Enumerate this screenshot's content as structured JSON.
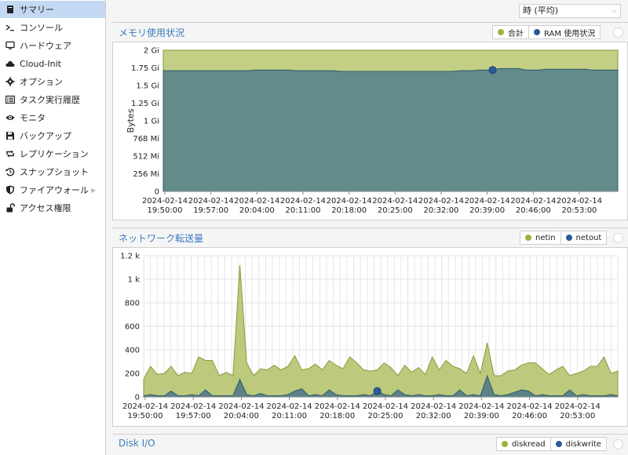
{
  "sidebar": {
    "items": [
      {
        "label": "サマリー",
        "icon": "book-icon"
      },
      {
        "label": "コンソール",
        "icon": "terminal-icon"
      },
      {
        "label": "ハードウェア",
        "icon": "desktop-icon"
      },
      {
        "label": "Cloud-Init",
        "icon": "cloud-icon"
      },
      {
        "label": "オプション",
        "icon": "gear-icon"
      },
      {
        "label": "タスク実行履歴",
        "icon": "list-icon"
      },
      {
        "label": "モニタ",
        "icon": "eye-icon"
      },
      {
        "label": "バックアップ",
        "icon": "floppy-icon"
      },
      {
        "label": "レプリケーション",
        "icon": "retweet-icon"
      },
      {
        "label": "スナップショット",
        "icon": "history-icon"
      },
      {
        "label": "ファイアウォール",
        "icon": "shield-icon"
      },
      {
        "label": "アクセス権限",
        "icon": "unlock-icon"
      }
    ]
  },
  "toolbar": {
    "timeframe": "時 (平均)"
  },
  "memory_panel": {
    "title": "メモリ使用状況",
    "legend": [
      {
        "label": "合計",
        "color": "#b5c46e"
      },
      {
        "label": "RAM 使用状況",
        "color": "#2b5c99"
      }
    ]
  },
  "network_panel": {
    "title": "ネットワーク転送量",
    "legend": [
      {
        "label": "netin",
        "color": "#9cb43c"
      },
      {
        "label": "netout",
        "color": "#2b5c99"
      }
    ]
  },
  "disk_panel": {
    "title": "Disk I/O",
    "legend": [
      {
        "label": "diskread",
        "color": "#9cb43c"
      },
      {
        "label": "diskwrite",
        "color": "#2b5c99"
      }
    ]
  },
  "chart_data": [
    {
      "type": "area",
      "ylabel": "Bytes",
      "ylim": [
        0,
        2
      ],
      "y_unit": "Gi",
      "yticks": [
        "0",
        "256 Mi",
        "512 Mi",
        "768 Mi",
        "1 Gi",
        "1.25 Gi",
        "1.5 Gi",
        "1.75 Gi",
        "2 Gi"
      ],
      "xticks": [
        [
          "2024-02-14",
          "19:50:00"
        ],
        [
          "2024-02-14",
          "19:57:00"
        ],
        [
          "2024-02-14",
          "20:04:00"
        ],
        [
          "2024-02-14",
          "20:11:00"
        ],
        [
          "2024-02-14",
          "20:18:00"
        ],
        [
          "2024-02-14",
          "20:25:00"
        ],
        [
          "2024-02-14",
          "20:32:00"
        ],
        [
          "2024-02-14",
          "20:39:00"
        ],
        [
          "2024-02-14",
          "20:46:00"
        ],
        [
          "2024-02-14",
          "20:53:00"
        ]
      ],
      "series": [
        {
          "name": "合計",
          "values": [
            2,
            2,
            2,
            2,
            2,
            2,
            2,
            2,
            2,
            2,
            2,
            2,
            2,
            2,
            2,
            2,
            2,
            2,
            2,
            2,
            2,
            2,
            2,
            2,
            2,
            2,
            2,
            2,
            2,
            2,
            2,
            2,
            2,
            2,
            2,
            2,
            2,
            2,
            2,
            2,
            2,
            2,
            2,
            2,
            2,
            2,
            2,
            2,
            2,
            2,
            2,
            2,
            2,
            2,
            2,
            2,
            2,
            2,
            2,
            2,
            2,
            2,
            2,
            2,
            2,
            2,
            2,
            2,
            2,
            2
          ]
        },
        {
          "name": "RAM 使用状況",
          "values": [
            1.71,
            1.71,
            1.71,
            1.71,
            1.71,
            1.71,
            1.71,
            1.71,
            1.71,
            1.71,
            1.71,
            1.71,
            1.71,
            1.71,
            1.72,
            1.72,
            1.72,
            1.72,
            1.72,
            1.72,
            1.71,
            1.71,
            1.71,
            1.71,
            1.71,
            1.71,
            1.71,
            1.7,
            1.7,
            1.7,
            1.7,
            1.7,
            1.7,
            1.7,
            1.7,
            1.7,
            1.7,
            1.7,
            1.7,
            1.7,
            1.7,
            1.7,
            1.7,
            1.7,
            1.7,
            1.71,
            1.71,
            1.71,
            1.72,
            1.72,
            1.72,
            1.74,
            1.74,
            1.74,
            1.74,
            1.72,
            1.72,
            1.72,
            1.73,
            1.73,
            1.73,
            1.73,
            1.73,
            1.73,
            1.73,
            1.72,
            1.72,
            1.72,
            1.72,
            1.72
          ]
        }
      ],
      "highlight": {
        "series": "RAM 使用状況",
        "index": 50
      }
    },
    {
      "type": "area",
      "ylim": [
        0,
        1200
      ],
      "yticks": [
        "0",
        "200",
        "400",
        "600",
        "800",
        "1 k",
        "1.2 k"
      ],
      "xticks": [
        [
          "2024-02-14",
          "19:50:00"
        ],
        [
          "2024-02-14",
          "19:57:00"
        ],
        [
          "2024-02-14",
          "20:04:00"
        ],
        [
          "2024-02-14",
          "20:11:00"
        ],
        [
          "2024-02-14",
          "20:18:00"
        ],
        [
          "2024-02-14",
          "20:25:00"
        ],
        [
          "2024-02-14",
          "20:32:00"
        ],
        [
          "2024-02-14",
          "20:39:00"
        ],
        [
          "2024-02-14",
          "20:46:00"
        ],
        [
          "2024-02-14",
          "20:53:00"
        ]
      ],
      "series": [
        {
          "name": "netin",
          "values": [
            150,
            260,
            190,
            200,
            260,
            180,
            210,
            200,
            340,
            310,
            310,
            180,
            210,
            180,
            1120,
            290,
            180,
            240,
            230,
            270,
            230,
            260,
            350,
            230,
            240,
            280,
            230,
            310,
            270,
            240,
            340,
            290,
            230,
            220,
            230,
            290,
            250,
            180,
            270,
            210,
            250,
            190,
            340,
            230,
            310,
            260,
            240,
            200,
            350,
            200,
            460,
            180,
            180,
            220,
            230,
            270,
            290,
            290,
            240,
            190,
            230,
            260,
            180,
            200,
            220,
            260,
            260,
            340,
            200,
            220
          ]
        },
        {
          "name": "netout",
          "values": [
            10,
            20,
            10,
            10,
            50,
            10,
            10,
            20,
            10,
            60,
            10,
            10,
            10,
            10,
            150,
            20,
            10,
            30,
            10,
            10,
            10,
            20,
            50,
            70,
            10,
            20,
            10,
            60,
            20,
            10,
            10,
            10,
            20,
            10,
            50,
            20,
            10,
            60,
            20,
            10,
            20,
            10,
            10,
            20,
            10,
            10,
            60,
            10,
            20,
            10,
            180,
            20,
            10,
            20,
            40,
            60,
            50,
            10,
            20,
            10,
            10,
            10,
            60,
            10,
            20,
            10,
            10,
            10,
            20,
            10
          ]
        }
      ],
      "highlight": {
        "series": "netout",
        "index": 34
      }
    }
  ]
}
